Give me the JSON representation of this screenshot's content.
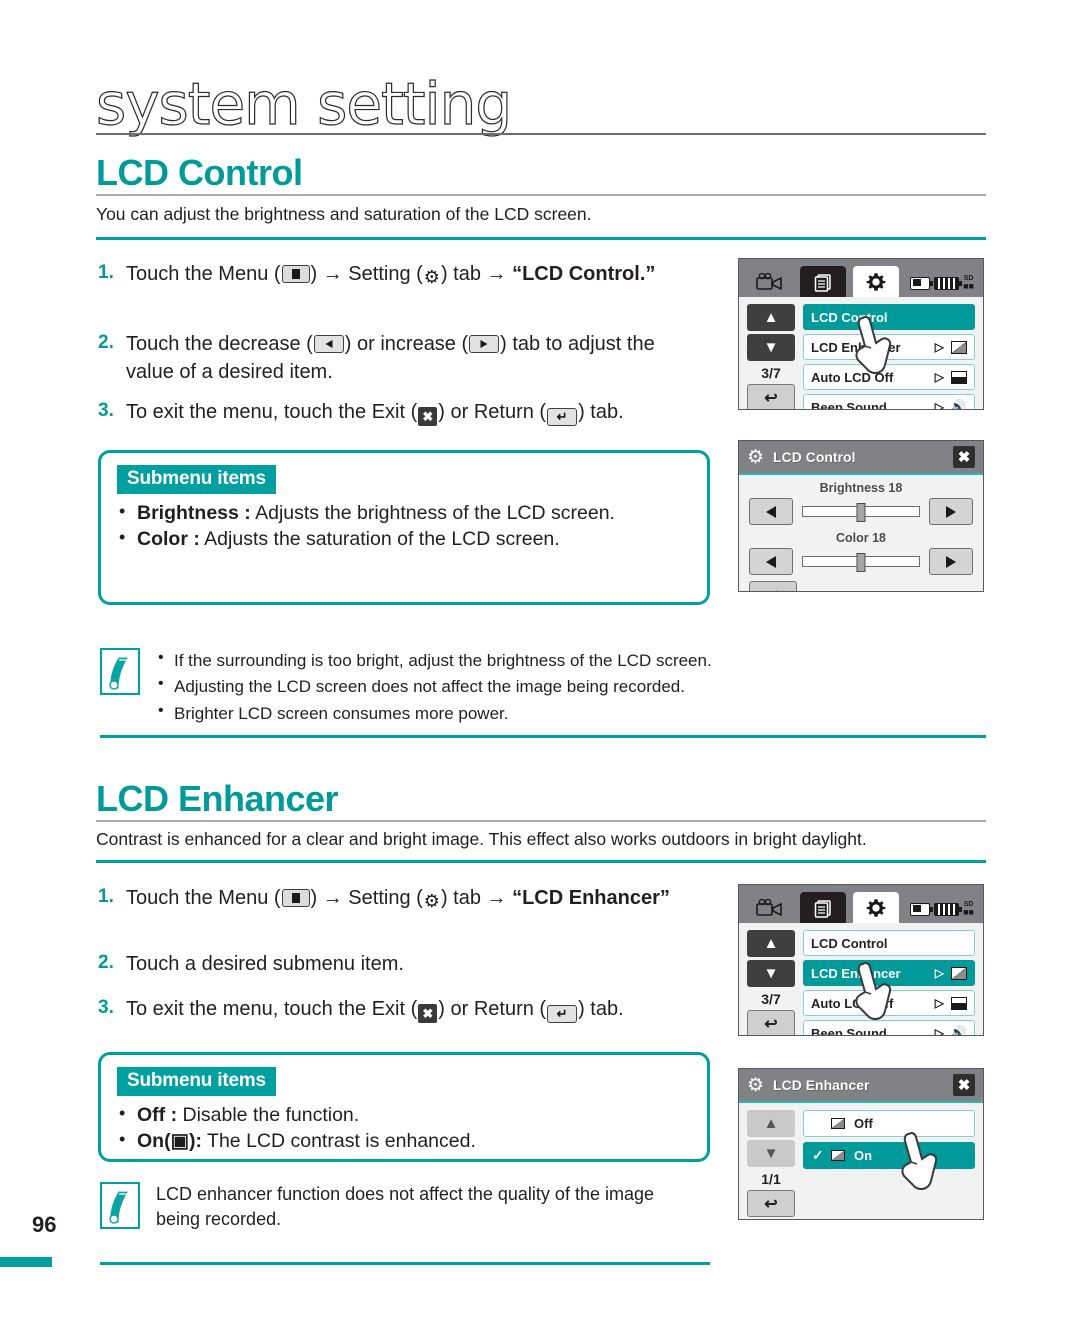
{
  "chapter": {
    "title": "system setting"
  },
  "page": {
    "number": "96"
  },
  "sections": [
    {
      "id": "lcd-control",
      "title": "LCD Control",
      "subtitle": "You can adjust the brightness and saturation of the LCD screen.",
      "steps": [
        {
          "num": "1.",
          "prefix": "Touch the Menu (",
          "icon1": "menu-icon",
          "mid": ") → Setting (",
          "icon2": "gear-icon",
          "suffix": ") tab → ",
          "bold": "“LCD Control.”"
        },
        {
          "num": "2.",
          "prefix": "Touch the decrease (",
          "icon1": "left-arrow-icon",
          "mid": ") or increase (",
          "icon2": "right-arrow-icon",
          "suffix": ") tab to adjust the value of a desired item.",
          "bold": ""
        },
        {
          "num": "3.",
          "prefix": "To exit the menu, touch the Exit (",
          "icon1": "exit-icon",
          "mid": ") or Return (",
          "icon2": "return-icon",
          "suffix": ") tab.",
          "bold": ""
        }
      ],
      "submenu": {
        "tag": "Submenu items",
        "items": [
          {
            "bold": "Brightness :",
            "text": " Adjusts the brightness of the LCD screen."
          },
          {
            "bold": "Color :",
            "text": " Adjusts the saturation of the LCD screen."
          }
        ]
      },
      "note": {
        "lines": [
          "If the surrounding is too bright, adjust the brightness of the LCD screen.",
          "Adjusting the LCD screen does not affect the image being recorded.",
          "Brighter LCD screen consumes more power."
        ]
      }
    },
    {
      "id": "lcd-enhancer",
      "title": "LCD Enhancer",
      "subtitle": "Contrast is enhanced for a clear and bright image. This effect also works outdoors in bright daylight.",
      "steps": [
        {
          "num": "1.",
          "prefix": "Touch the Menu (",
          "icon1": "menu-icon",
          "mid": ") → Setting (",
          "icon2": "gear-icon",
          "suffix": ") tab → ",
          "bold": "“LCD Enhancer”"
        },
        {
          "num": "2.",
          "prefix": "Touch a desired submenu item.",
          "icon1": "",
          "mid": "",
          "icon2": "",
          "suffix": "",
          "bold": ""
        },
        {
          "num": "3.",
          "prefix": "To exit the menu, touch the Exit (",
          "icon1": "exit-icon",
          "mid": ") or Return (",
          "icon2": "return-icon",
          "suffix": ") tab.",
          "bold": ""
        }
      ],
      "submenu": {
        "tag": "Submenu items",
        "items": [
          {
            "bold": "Off :",
            "text": " Disable the function."
          },
          {
            "bold": "On(▣):",
            "text": " The LCD contrast is enhanced."
          }
        ]
      },
      "note": {
        "text": "LCD enhancer function does not affect the quality of the image being recorded."
      }
    }
  ],
  "lcd_screens": {
    "setting_menu_1": {
      "tabs": [
        {
          "name": "camcorder-tab",
          "state": "inactive"
        },
        {
          "name": "playback-tab",
          "state": "dark"
        },
        {
          "name": "setting-tab",
          "state": "active"
        }
      ],
      "status": {
        "battery_small": "battery-low-icon",
        "battery_full": "battery-full-icon",
        "card": "SD"
      },
      "nav": {
        "up": "▲",
        "down": "▼",
        "page": "3/7",
        "return": "↩"
      },
      "rows": [
        {
          "label": "LCD Control",
          "active": true,
          "has_arrow": false,
          "endicon": ""
        },
        {
          "label": "LCD Enhancer",
          "active": false,
          "has_arrow": true,
          "endicon": "enhancer-icon"
        },
        {
          "label": "Auto LCD Off",
          "active": false,
          "has_arrow": true,
          "endicon": "monitor-icon"
        },
        {
          "label": "Beep Sound",
          "active": false,
          "has_arrow": true,
          "endicon": "speaker-icon"
        }
      ]
    },
    "lcd_control_dialog": {
      "title": "LCD Control",
      "exit": "✖",
      "sliders": [
        {
          "label": "Brightness 18",
          "value": 18,
          "min": 0,
          "max": 36
        },
        {
          "label": "Color 18",
          "value": 18,
          "min": 0,
          "max": 36
        }
      ],
      "return": "↩"
    },
    "setting_menu_2": {
      "tabs": [
        {
          "name": "camcorder-tab",
          "state": "inactive"
        },
        {
          "name": "playback-tab",
          "state": "dark"
        },
        {
          "name": "setting-tab",
          "state": "active"
        }
      ],
      "status": {
        "battery_small": "battery-low-icon",
        "battery_full": "battery-full-icon",
        "card": "SD"
      },
      "nav": {
        "up": "▲",
        "down": "▼",
        "page": "3/7",
        "return": "↩"
      },
      "rows": [
        {
          "label": "LCD Control",
          "active": false,
          "has_arrow": false,
          "endicon": ""
        },
        {
          "label": "LCD Enhancer",
          "active": true,
          "has_arrow": true,
          "endicon": "enhancer-icon"
        },
        {
          "label": "Auto LCD Off",
          "active": false,
          "has_arrow": true,
          "endicon": "monitor-icon"
        },
        {
          "label": "Beep Sound",
          "active": false,
          "has_arrow": true,
          "endicon": "speaker-icon"
        }
      ]
    },
    "lcd_enhancer_dialog": {
      "title": "LCD Enhancer",
      "exit": "✖",
      "nav": {
        "up": "▲",
        "down": "▼",
        "page": "1/1",
        "return": "↩"
      },
      "options": [
        {
          "label": "Off",
          "checked": false,
          "active": false,
          "icon": "enhancer-off-icon"
        },
        {
          "label": "On",
          "checked": true,
          "active": true,
          "icon": "enhancer-on-icon"
        }
      ]
    }
  },
  "colors": {
    "accent_teal": "#009a9a",
    "rule_teal": "#00a0a0",
    "lcd_topbar_grey": "#808285",
    "text_dark": "#231f20"
  }
}
